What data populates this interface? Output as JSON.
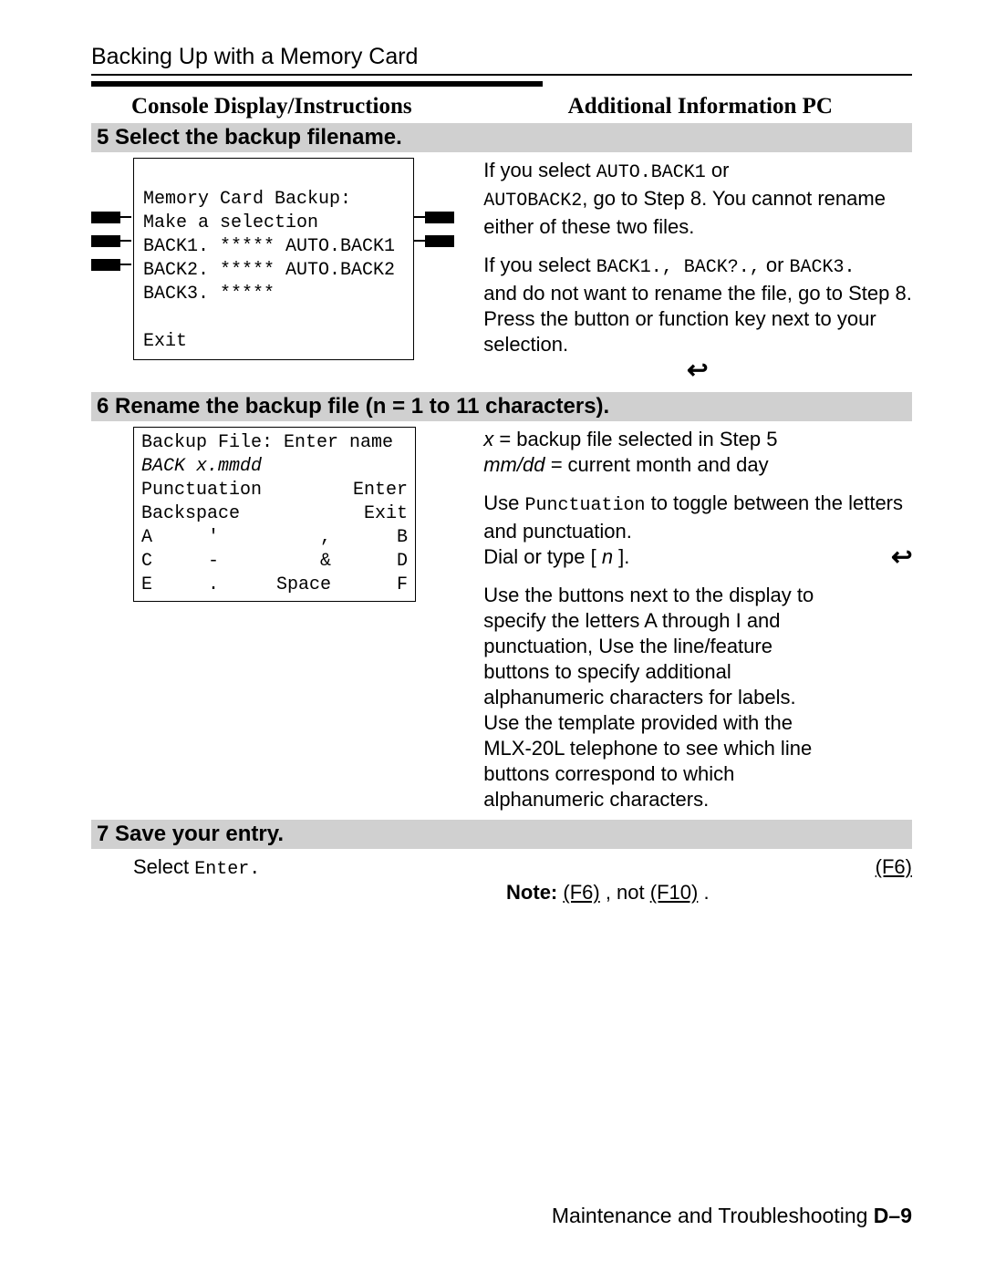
{
  "header": {
    "running_head": "Backing Up with a Memory Card"
  },
  "columns": {
    "left_label": "Console Display/Instructions",
    "right_label": "Additional  Information  PC"
  },
  "step5": {
    "bar": "5 Select the backup filename.",
    "console": {
      "line1": "Memory Card Backup:",
      "line2": "Make a selection",
      "line3": "BACK1. ***** AUTO.BACK1",
      "line4": "BACK2. ***** AUTO.BACK2",
      "line5": "BACK3. *****",
      "blank": "",
      "exit": "Exit"
    },
    "info": {
      "p1a": "If you select ",
      "p1_mono1": "AUTO.BACK1",
      "p1b": " or",
      "p1_mono2": "AUTOBACK2",
      "p1c": ", go to Step 8. You cannot rename either of these two files.",
      "p2a": "If you select ",
      "p2_mono": "BACK1., BACK?.,",
      "p2b": " or ",
      "p2_mono2": "BACK3.",
      "p2c": " and do not want to rename the file, go to Step 8.",
      "p3": "Press the button or function key next to your selection."
    }
  },
  "step6": {
    "bar": "6 Rename the backup file (n = 1 to 11 characters).",
    "console_box": {
      "line1": "Backup File: Enter name",
      "line2": "BACK x.mmdd",
      "row_punct_l": "Punctuation",
      "row_punct_r": "Enter",
      "row_back_l": "Backspace",
      "row_back_r": "Exit",
      "A": "A",
      "q": "'",
      "comma": ",",
      "B": "B",
      "C": "C",
      "dash": "-",
      "amp": "&",
      "D": "D",
      "E": "E",
      "dot": ".",
      "space": "Space",
      "F": "F"
    },
    "info": {
      "eq1a": "x",
      "eq1b": " = backup file selected in Step 5",
      "eq2a": "mm/dd =",
      "eq2b": " current month and day",
      "p1a": "Use ",
      "p1_mono": "Punctuation",
      "p1b": " to toggle between the letters and punctuation.",
      "p2a": "Dial or type [ ",
      "p2_it": "n",
      "p2b": " ].",
      "p3": "Use the buttons next to the display to specify the letters A through I and punctuation, Use the line/feature buttons to specify additional alphanumeric characters for labels. Use the template provided with the MLX-20L telephone to see which line buttons correspond to which alphanumeric characters."
    }
  },
  "step7": {
    "bar": "7 Save your entry.",
    "left": {
      "a": "Select ",
      "mono": "Enter."
    },
    "note_label": "Note:",
    "note_body_a": "(F6)",
    "note_body_b": " , not ",
    "note_body_c": "(F10)",
    "note_body_d": " .",
    "right_key": "(F6)"
  },
  "footer": {
    "a": "Maintenance and Troubleshooting ",
    "b": "D–9"
  }
}
